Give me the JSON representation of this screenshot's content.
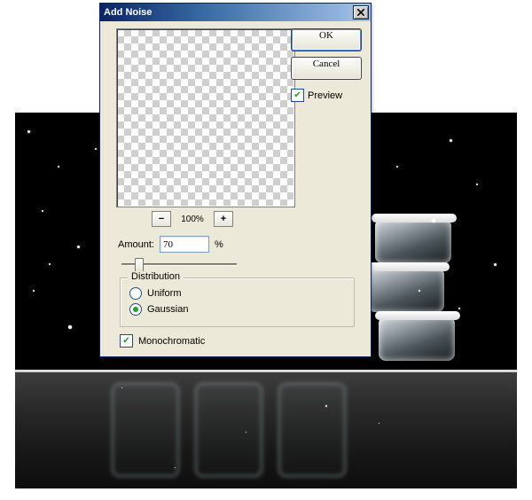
{
  "dialog": {
    "title": "Add Noise",
    "buttons": {
      "ok": "OK",
      "cancel": "Cancel"
    },
    "preview_label": "Preview",
    "preview_checked": true,
    "zoom": {
      "out": "−",
      "in": "+",
      "value": "100%"
    },
    "amount": {
      "label": "Amount:",
      "value": "70",
      "unit": "%"
    },
    "distribution": {
      "label": "Distribution",
      "options": [
        "Uniform",
        "Gaussian"
      ],
      "selected": "Gaussian"
    },
    "monochromatic_label": "Monochromatic",
    "monochromatic_checked": true
  }
}
